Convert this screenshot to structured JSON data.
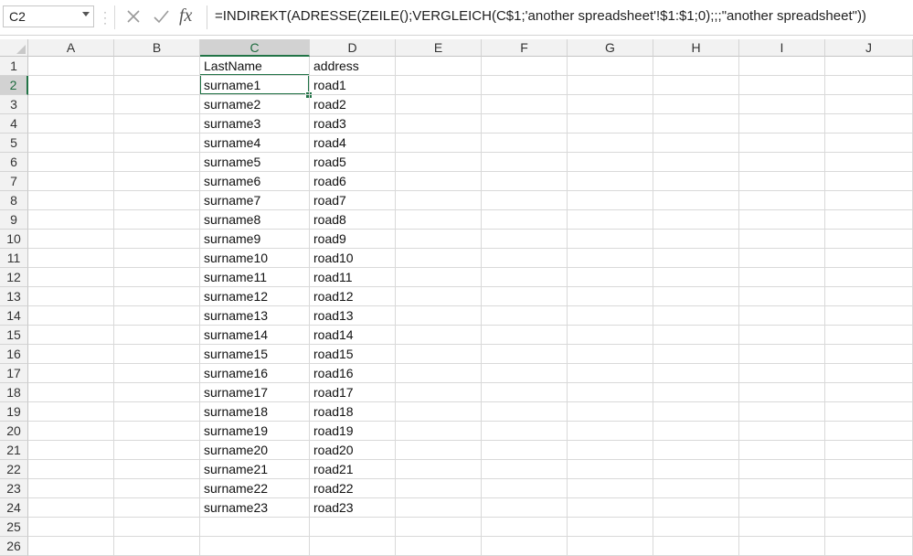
{
  "name_box": {
    "value": "C2"
  },
  "formula_bar": {
    "formula": "=INDIREKT(ADRESSE(ZEILE();VERGLEICH(C$1;'another spreadsheet'!$1:$1;0);;;\"another spreadsheet\"))",
    "fx_label": "fx"
  },
  "columns": [
    "A",
    "B",
    "C",
    "D",
    "E",
    "F",
    "G",
    "H",
    "I",
    "J"
  ],
  "selected_column": "C",
  "selected_row": 2,
  "rows": [
    "1",
    "2",
    "3",
    "4",
    "5",
    "6",
    "7",
    "8",
    "9",
    "10",
    "11",
    "12",
    "13",
    "14",
    "15",
    "16",
    "17",
    "18",
    "19",
    "20",
    "21",
    "22",
    "23",
    "24",
    "25",
    "26"
  ],
  "column_c": [
    "LastName",
    "surname1",
    "surname2",
    "surname3",
    "surname4",
    "surname5",
    "surname6",
    "surname7",
    "surname8",
    "surname9",
    "surname10",
    "surname11",
    "surname12",
    "surname13",
    "surname14",
    "surname15",
    "surname16",
    "surname17",
    "surname18",
    "surname19",
    "surname20",
    "surname21",
    "surname22",
    "surname23"
  ],
  "column_d": [
    "address",
    "road1",
    "road2",
    "road3",
    "road4",
    "road5",
    "road6",
    "road7",
    "road8",
    "road9",
    "road10",
    "road11",
    "road12",
    "road13",
    "road14",
    "road15",
    "road16",
    "road17",
    "road18",
    "road19",
    "road20",
    "road21",
    "road22",
    "road23"
  ],
  "colors": {
    "accent": "#217346",
    "header_bg": "#f2f2f2",
    "gridline": "#d9d9d9"
  }
}
